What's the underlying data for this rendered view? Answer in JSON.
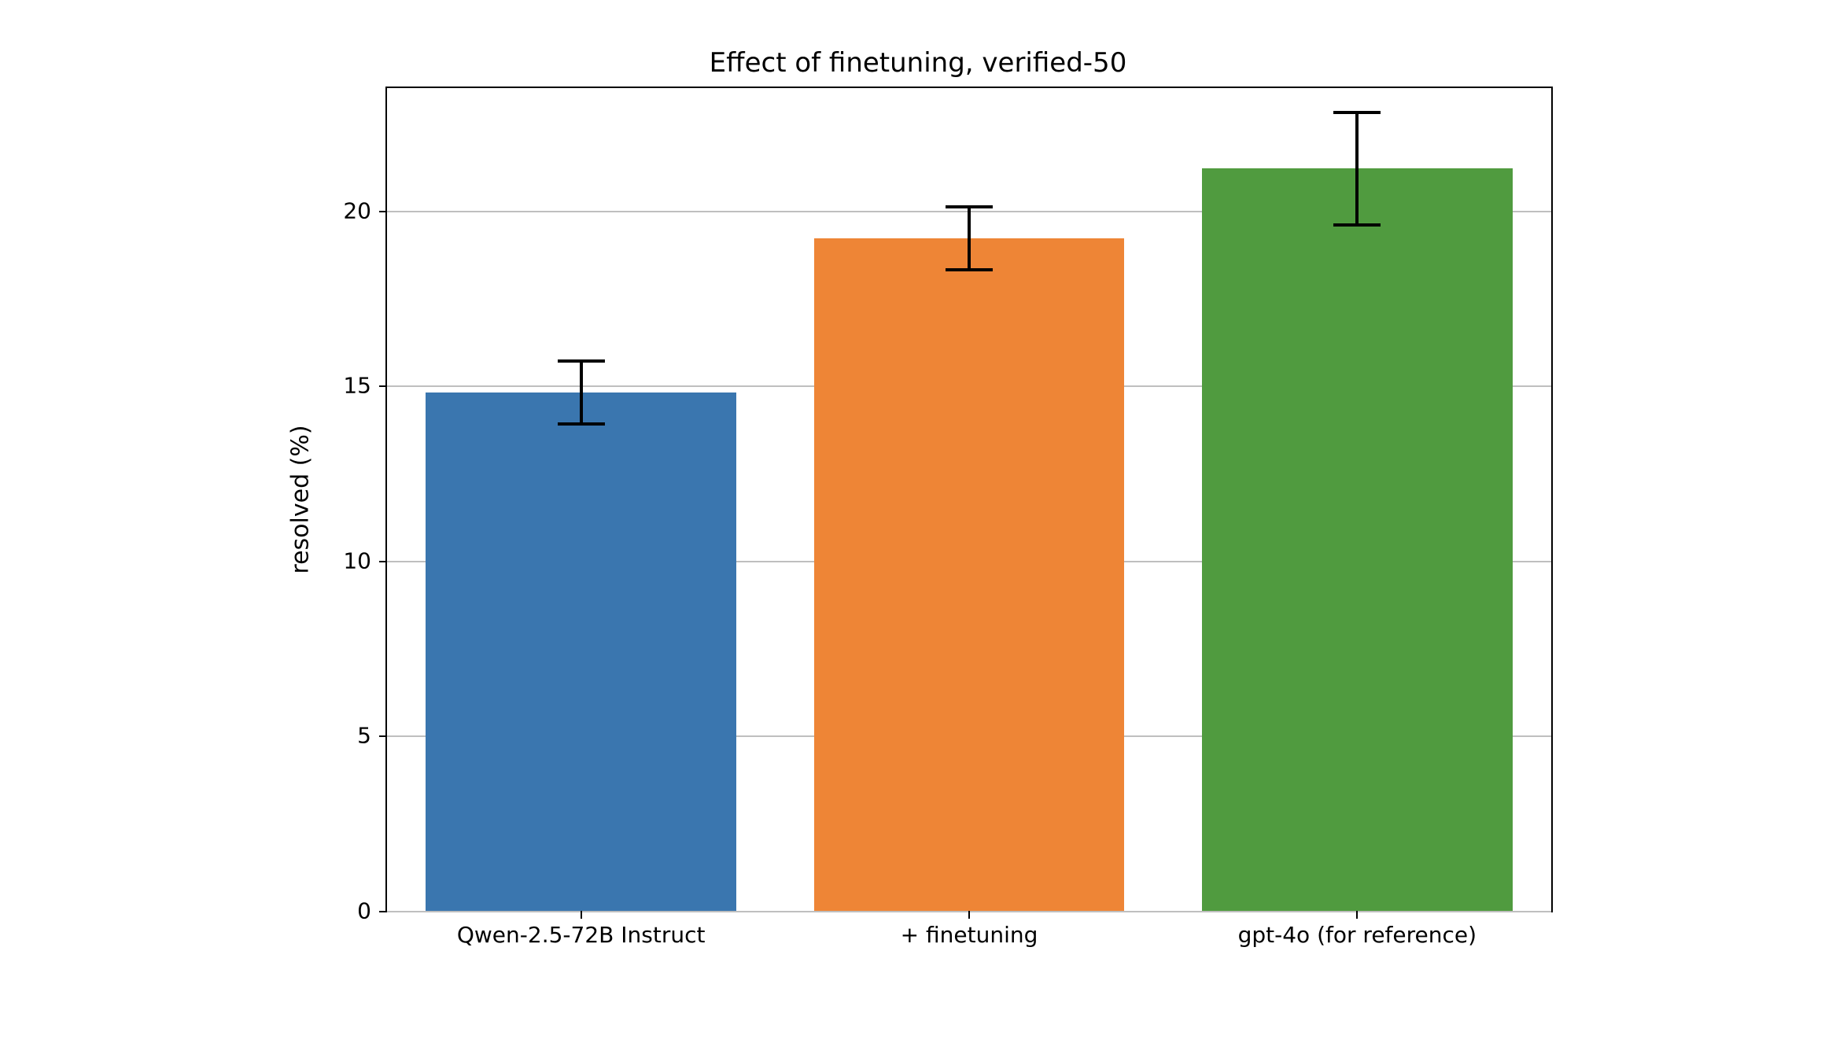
{
  "chart_data": {
    "type": "bar",
    "title": "Effect of finetuning, verified-50",
    "ylabel": "resolved (%)",
    "xlabel": "",
    "categories": [
      "Qwen-2.5-72B Instruct",
      "+ finetuning",
      "gpt-4o (for reference)"
    ],
    "values": [
      14.8,
      19.2,
      21.2
    ],
    "errors_low": [
      0.9,
      0.9,
      1.6
    ],
    "errors_high": [
      0.9,
      0.9,
      1.6
    ],
    "yticks": [
      0,
      5,
      10,
      15,
      20
    ],
    "ylim": [
      0,
      23.5
    ],
    "colors": [
      "#3a76af",
      "#ee8536",
      "#509b3f"
    ],
    "bar_width_frac": 0.8,
    "grid": true
  }
}
